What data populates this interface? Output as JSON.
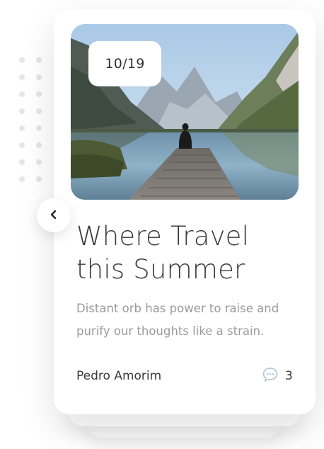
{
  "post": {
    "date": "10/19",
    "title_line1": "Where Travel",
    "title_line2": "this Summer",
    "excerpt": "Distant orb has power to raise and purify our thoughts like a strain.",
    "author": "Pedro Amorim",
    "comment_count": "3"
  },
  "icons": {
    "back": "chevron-left-icon",
    "comments": "speech-bubble-icon"
  },
  "colors": {
    "background": "#ffffff",
    "title": "#3a3a3a",
    "excerpt": "#9b9b9b",
    "comment_icon": "#b9c8d8"
  }
}
